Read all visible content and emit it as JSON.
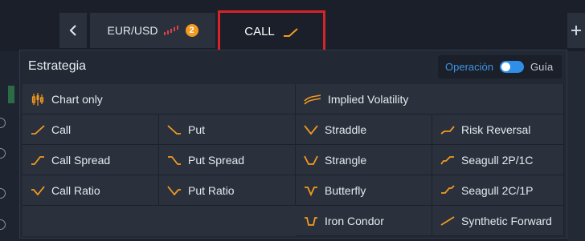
{
  "tabs": {
    "asset": {
      "label": "EUR/USD",
      "badge": "2"
    },
    "strategy": {
      "label": "CALL"
    }
  },
  "panel": {
    "title": "Estrategia",
    "mode": {
      "active": "Operación",
      "inactive": "Guía",
      "toggle_on": true
    }
  },
  "strategies": {
    "chart_only": "Chart only",
    "implied_volatility": "Implied Volatility",
    "call": "Call",
    "put": "Put",
    "straddle": "Straddle",
    "risk_reversal": "Risk Reversal",
    "call_spread": "Call Spread",
    "put_spread": "Put Spread",
    "strangle": "Strangle",
    "seagull_2p1c": "Seagull 2P/1C",
    "call_ratio": "Call Ratio",
    "put_ratio": "Put Ratio",
    "butterfly": "Butterfly",
    "seagull_2c1p": "Seagull 2C/1P",
    "iron_condor": "Iron Condor",
    "synthetic_forward": "Synthetic Forward"
  },
  "colors": {
    "accent": "#f39a1f",
    "highlight_border": "#d9232b",
    "toggle": "#2f8fe8"
  }
}
